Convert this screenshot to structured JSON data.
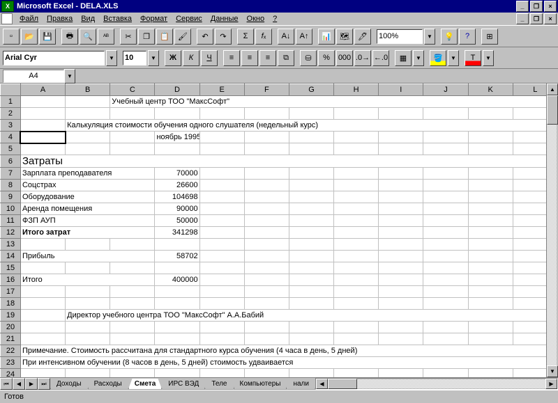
{
  "title": "Microsoft Excel - DELA.XLS",
  "menu": {
    "file": "Файл",
    "edit": "Правка",
    "view": "Вид",
    "insert": "Вставка",
    "format": "Формат",
    "tools": "Сервис",
    "data": "Данные",
    "window": "Окно",
    "help": "?"
  },
  "toolbar": {
    "zoom": "100%"
  },
  "format": {
    "font": "Arial Cyr",
    "size": "10",
    "bold": "Ж",
    "italic": "К",
    "underline": "Ч"
  },
  "namebox": "A4",
  "columns": [
    "A",
    "B",
    "C",
    "D",
    "E",
    "F",
    "G",
    "H",
    "I",
    "J",
    "K",
    "L"
  ],
  "rows": {
    "1": {
      "c": "Учебный центр ТОО \"МаксСофт\""
    },
    "3": {
      "b": "Калькуляция стоимости обучения одного слушателя (недельный курс)"
    },
    "4": {
      "d": "ноябрь 1995"
    },
    "6": {
      "a": "Затраты"
    },
    "7": {
      "a": "Зарплата преподавателя",
      "d": "70000"
    },
    "8": {
      "a": "Соцстрах",
      "d": "26600"
    },
    "9": {
      "a": "Оборудование",
      "d": "104698"
    },
    "10": {
      "a": "Аренда помещения",
      "d": "90000"
    },
    "11": {
      "a": "ФЗП АУП",
      "d": "50000"
    },
    "12": {
      "a": "Итого затрат",
      "d": "341298"
    },
    "14": {
      "a": "Прибыль",
      "d": "58702"
    },
    "16": {
      "a": "Итого",
      "d": "400000"
    },
    "19": {
      "b": "Директор учебного центра ТОО \"МаксСофт\"   А.А.Бабий"
    },
    "22": {
      "a": "Примечание. Стоимость рассчитана для стандартного курса обучения (4 часа в день, 5 дней)"
    },
    "23": {
      "a": "При интенсивном обучении (8 часов в день, 5 дней) стоимость удваивается"
    }
  },
  "tabs": [
    "Доходы",
    "Расходы",
    "Смета",
    "ИРС ВЭД",
    "Теле",
    "Компьютеры",
    "нали"
  ],
  "active_tab": "Смета",
  "status": "Готов"
}
